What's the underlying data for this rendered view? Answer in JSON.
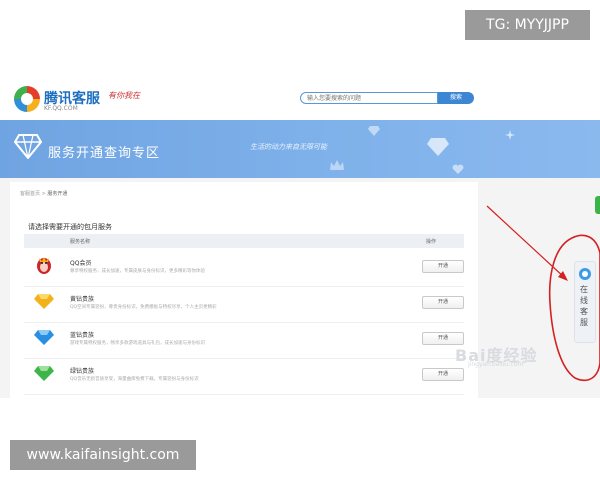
{
  "watermarks": {
    "top": "TG: MYYJJPP",
    "bottom": "www.kaifainsight.com"
  },
  "header": {
    "brand": "腾讯客服",
    "brand_sub": "KF.QQ.COM",
    "slogan": "有你我在",
    "search_placeholder": "输入您要搜索的问题",
    "search_button": "搜索"
  },
  "banner": {
    "title": "服务开通查询专区",
    "slogan": "生活的动力来自无限可能",
    "color": "#78abe6"
  },
  "breadcrumb": {
    "home": "客服首页",
    "separator": ">",
    "current": "服务开通"
  },
  "content": {
    "prompt": "请选择需要开通的包月服务",
    "columns": {
      "service": "服务名称",
      "action": "操作"
    },
    "services": [
      {
        "name": "QQ会员",
        "desc": "尊享特权服务，成长加速，专属皮肤与身份标识，更多精彩等你体验",
        "button": "开通",
        "icon": "qq-penguin-icon",
        "color": "#c9262b"
      },
      {
        "name": "黄钻贵族",
        "desc": "QQ空间专属装扮，尊贵身份标识，免费模板与特权尽享，个人主页更精彩",
        "button": "开通",
        "icon": "yellow-diamond-icon",
        "color": "#f3b21c"
      },
      {
        "name": "蓝钻贵族",
        "desc": "游戏专属特权服务，畅享多款游戏道具与礼包，成长加速与身份标识",
        "button": "开通",
        "icon": "blue-diamond-icon",
        "color": "#2a8fe0"
      },
      {
        "name": "绿钻贵族",
        "desc": "QQ音乐无损音质享受，海量曲库免费下载，专属装扮与身份标识",
        "button": "开通",
        "icon": "green-diamond-icon",
        "color": "#3db54a"
      }
    ]
  },
  "side_widget": {
    "label": "在线客服",
    "accent": "#3c9be6"
  },
  "annotation": {
    "color": "#d42020"
  },
  "overlay_watermark": {
    "text": "Bai度经验",
    "sub": "jingyan.baidu.com"
  }
}
